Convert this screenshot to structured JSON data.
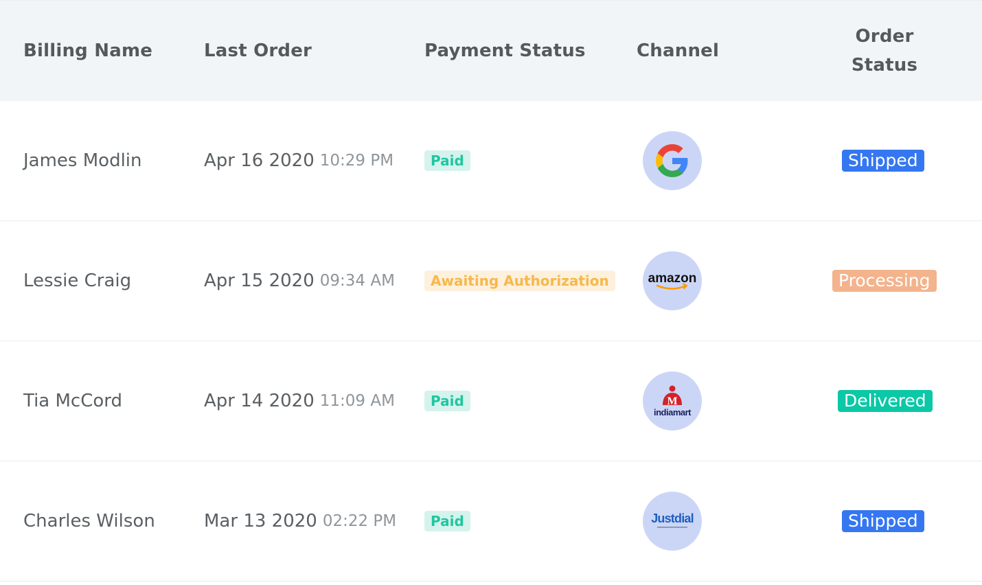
{
  "columns": {
    "billing_name": "Billing Name",
    "last_order": "Last Order",
    "payment_status": "Payment Status",
    "channel": "Channel",
    "order_status_line1": "Order",
    "order_status_line2": "Status"
  },
  "rows": [
    {
      "name": "James Modlin",
      "date": "Apr 16 2020",
      "time": "10:29 PM",
      "payment": "Paid",
      "payment_kind": "success",
      "channel_icon": "google-icon",
      "order_status": "Shipped",
      "order_kind": "shipped"
    },
    {
      "name": "Lessie Craig",
      "date": "Apr 15 2020",
      "time": "09:34 AM",
      "payment": "Awaiting Authorization",
      "payment_kind": "warning",
      "channel_icon": "amazon-icon",
      "channel_text": "amazon",
      "order_status": "Processing",
      "order_kind": "processing"
    },
    {
      "name": "Tia McCord",
      "date": "Apr 14 2020",
      "time": "11:09 AM",
      "payment": "Paid",
      "payment_kind": "success",
      "channel_icon": "indiamart-icon",
      "channel_text": "indiamart",
      "order_status": "Delivered",
      "order_kind": "delivered"
    },
    {
      "name": "Charles Wilson",
      "date": "Mar 13 2020",
      "time": "02:22 PM",
      "payment": "Paid",
      "payment_kind": "success",
      "channel_icon": "justdial-icon",
      "channel_text": "Justdial",
      "order_status": "Shipped",
      "order_kind": "shipped"
    }
  ],
  "colors": {
    "paid_bg": "#d4f3ec",
    "paid_text": "#22c5a0",
    "awaiting_bg": "#fdf0dc",
    "awaiting_text": "#f7b84b",
    "shipped_bg": "#3577f1",
    "processing_bg": "#f3b38c",
    "delivered_bg": "#0bc8a6",
    "channel_circle": "#cbd6f7"
  }
}
